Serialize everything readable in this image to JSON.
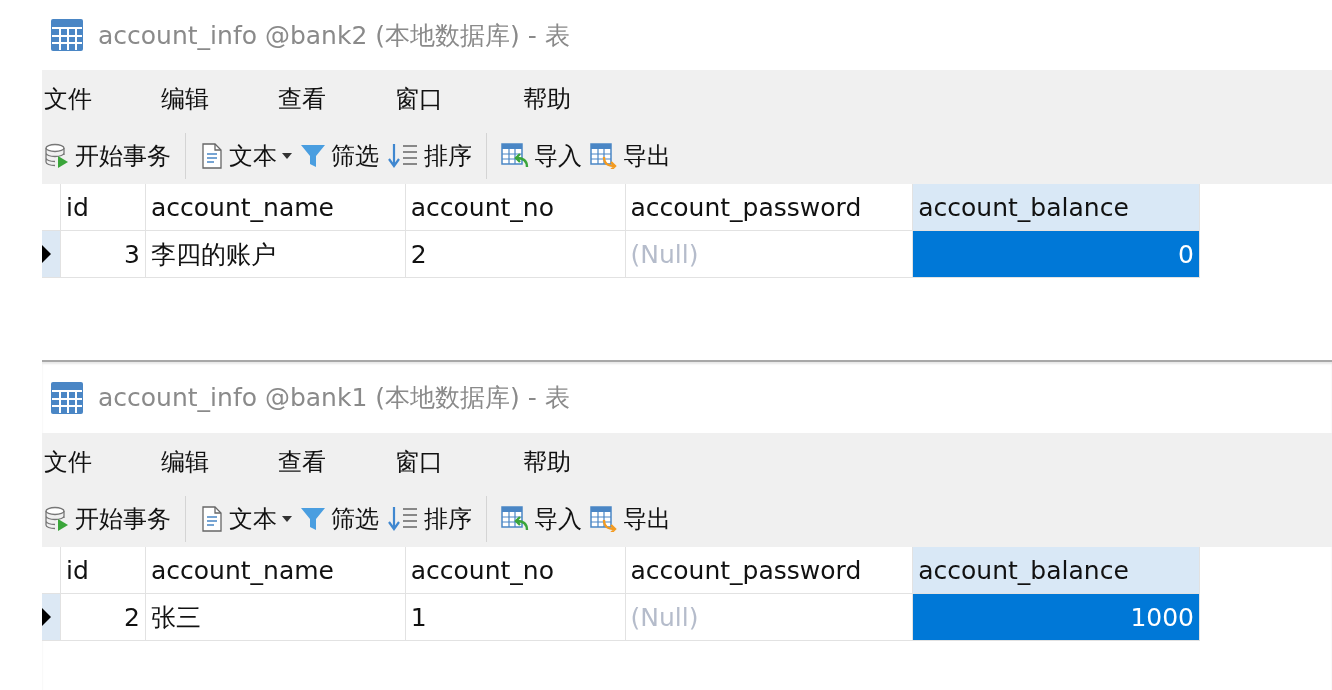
{
  "panels": [
    {
      "title": "account_info @bank2 (本地数据库) - 表",
      "menu": [
        "文件",
        "编辑",
        "查看",
        "窗口",
        "帮助"
      ],
      "toolbar": [
        {
          "kind": "transaction",
          "label": "开始事务"
        },
        {
          "kind": "separator"
        },
        {
          "kind": "text",
          "label": "文本"
        },
        {
          "kind": "filter",
          "label": "筛选"
        },
        {
          "kind": "sort",
          "label": "排序"
        },
        {
          "kind": "separator"
        },
        {
          "kind": "import",
          "label": "导入"
        },
        {
          "kind": "export",
          "label": "导出"
        }
      ],
      "columns": [
        {
          "label": "id",
          "kind": "number",
          "selected": false
        },
        {
          "label": "account_name",
          "kind": "text",
          "selected": false
        },
        {
          "label": "account_no",
          "kind": "text",
          "selected": false
        },
        {
          "label": "account_password",
          "kind": "text",
          "selected": false
        },
        {
          "label": "account_balance",
          "kind": "number",
          "selected": true
        }
      ],
      "rows": [
        {
          "current": true,
          "cells": [
            {
              "text": "3",
              "null": false,
              "selected": false
            },
            {
              "text": "李四的账户",
              "null": false,
              "selected": false
            },
            {
              "text": "2",
              "null": false,
              "selected": false
            },
            {
              "text": "(Null)",
              "null": true,
              "selected": false
            },
            {
              "text": "0",
              "null": false,
              "selected": true
            }
          ]
        }
      ]
    },
    {
      "title": "account_info @bank1 (本地数据库) - 表",
      "menu": [
        "文件",
        "编辑",
        "查看",
        "窗口",
        "帮助"
      ],
      "toolbar": [
        {
          "kind": "transaction",
          "label": "开始事务"
        },
        {
          "kind": "separator"
        },
        {
          "kind": "text",
          "label": "文本"
        },
        {
          "kind": "filter",
          "label": "筛选"
        },
        {
          "kind": "sort",
          "label": "排序"
        },
        {
          "kind": "separator"
        },
        {
          "kind": "import",
          "label": "导入"
        },
        {
          "kind": "export",
          "label": "导出"
        }
      ],
      "columns": [
        {
          "label": "id",
          "kind": "number",
          "selected": false
        },
        {
          "label": "account_name",
          "kind": "text",
          "selected": false
        },
        {
          "label": "account_no",
          "kind": "text",
          "selected": false
        },
        {
          "label": "account_password",
          "kind": "text",
          "selected": false
        },
        {
          "label": "account_balance",
          "kind": "number",
          "selected": true
        }
      ],
      "rows": [
        {
          "current": true,
          "cells": [
            {
              "text": "2",
              "null": false,
              "selected": false
            },
            {
              "text": "张三",
              "null": false,
              "selected": false
            },
            {
              "text": "1",
              "null": false,
              "selected": false
            },
            {
              "text": "(Null)",
              "null": true,
              "selected": false
            },
            {
              "text": "1000",
              "null": false,
              "selected": true
            }
          ]
        }
      ]
    }
  ]
}
